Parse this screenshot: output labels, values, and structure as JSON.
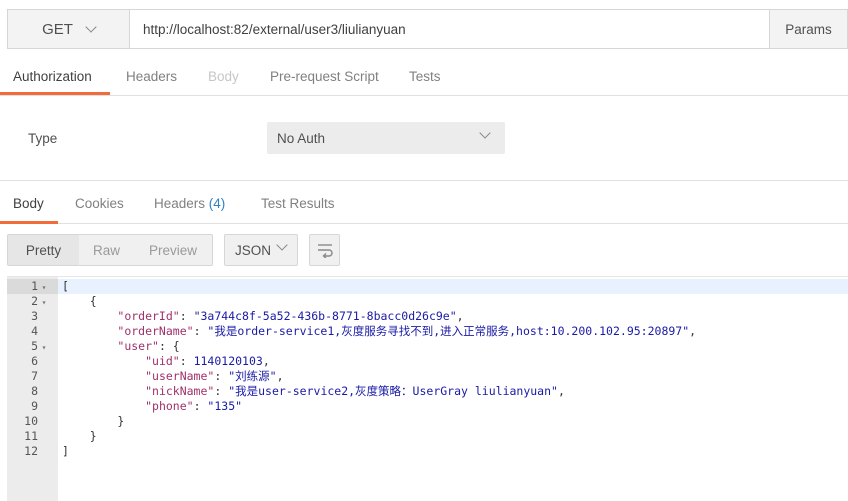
{
  "request": {
    "method": "GET",
    "url": "http://localhost:82/external/user3/liulianyuan",
    "params_label": "Params"
  },
  "request_tabs": [
    {
      "label": "Authorization",
      "state": "active"
    },
    {
      "label": "Headers",
      "state": "normal"
    },
    {
      "label": "Body",
      "state": "disabled"
    },
    {
      "label": "Pre-request Script",
      "state": "normal"
    },
    {
      "label": "Tests",
      "state": "normal"
    }
  ],
  "auth": {
    "type_label": "Type",
    "selected": "No Auth"
  },
  "response_tabs": {
    "body": "Body",
    "cookies": "Cookies",
    "headers": "Headers",
    "headers_count": "(4)",
    "test_results": "Test Results"
  },
  "view": {
    "pretty": "Pretty",
    "raw": "Raw",
    "preview": "Preview",
    "format": "JSON"
  },
  "colors": {
    "accent": "#f26b3a",
    "key": "#a0306a",
    "string": "#1a1aa6",
    "count": "#2f80c8"
  },
  "response_body": {
    "orderId": "3a744c8f-5a52-436b-8771-8bacc0d26c9e",
    "orderName": "我是order-service1,灰度服务寻找不到,进入正常服务,host:10.200.102.95:20897",
    "user": {
      "uid": 1140120103,
      "userName": "刘练源",
      "nickName": "我是user-service2,灰度策略：UserGray liulianyuan",
      "phone": "135"
    }
  },
  "lines": [
    {
      "n": "1",
      "fold": "▾",
      "text": "[",
      "current": true
    },
    {
      "n": "2",
      "fold": "▾",
      "text": "    {"
    },
    {
      "n": "3",
      "fold": "",
      "indent": "        ",
      "key": "\"orderId\"",
      "sep": ": ",
      "val": "\"3a744c8f-5a52-436b-8771-8bacc0d26c9e\"",
      "end": ","
    },
    {
      "n": "4",
      "fold": "",
      "indent": "        ",
      "key": "\"orderName\"",
      "sep": ": ",
      "val": "\"我是order-service1,灰度服务寻找不到,进入正常服务,host:10.200.102.95:20897\"",
      "end": ","
    },
    {
      "n": "5",
      "fold": "▾",
      "indent": "        ",
      "key": "\"user\"",
      "sep": ": {",
      "val": "",
      "end": ""
    },
    {
      "n": "6",
      "fold": "",
      "indent": "            ",
      "key": "\"uid\"",
      "sep": ": ",
      "val": "1140120103",
      "end": ","
    },
    {
      "n": "7",
      "fold": "",
      "indent": "            ",
      "key": "\"userName\"",
      "sep": ": ",
      "val": "\"刘练源\"",
      "end": ","
    },
    {
      "n": "8",
      "fold": "",
      "indent": "            ",
      "key": "\"nickName\"",
      "sep": ": ",
      "val": "\"我是user-service2,灰度策略：UserGray liulianyuan\"",
      "end": ","
    },
    {
      "n": "9",
      "fold": "",
      "indent": "            ",
      "key": "\"phone\"",
      "sep": ": ",
      "val": "\"135\"",
      "end": ""
    },
    {
      "n": "10",
      "fold": "",
      "text": "        }"
    },
    {
      "n": "11",
      "fold": "",
      "text": "    }"
    },
    {
      "n": "12",
      "fold": "",
      "text": "]"
    }
  ]
}
